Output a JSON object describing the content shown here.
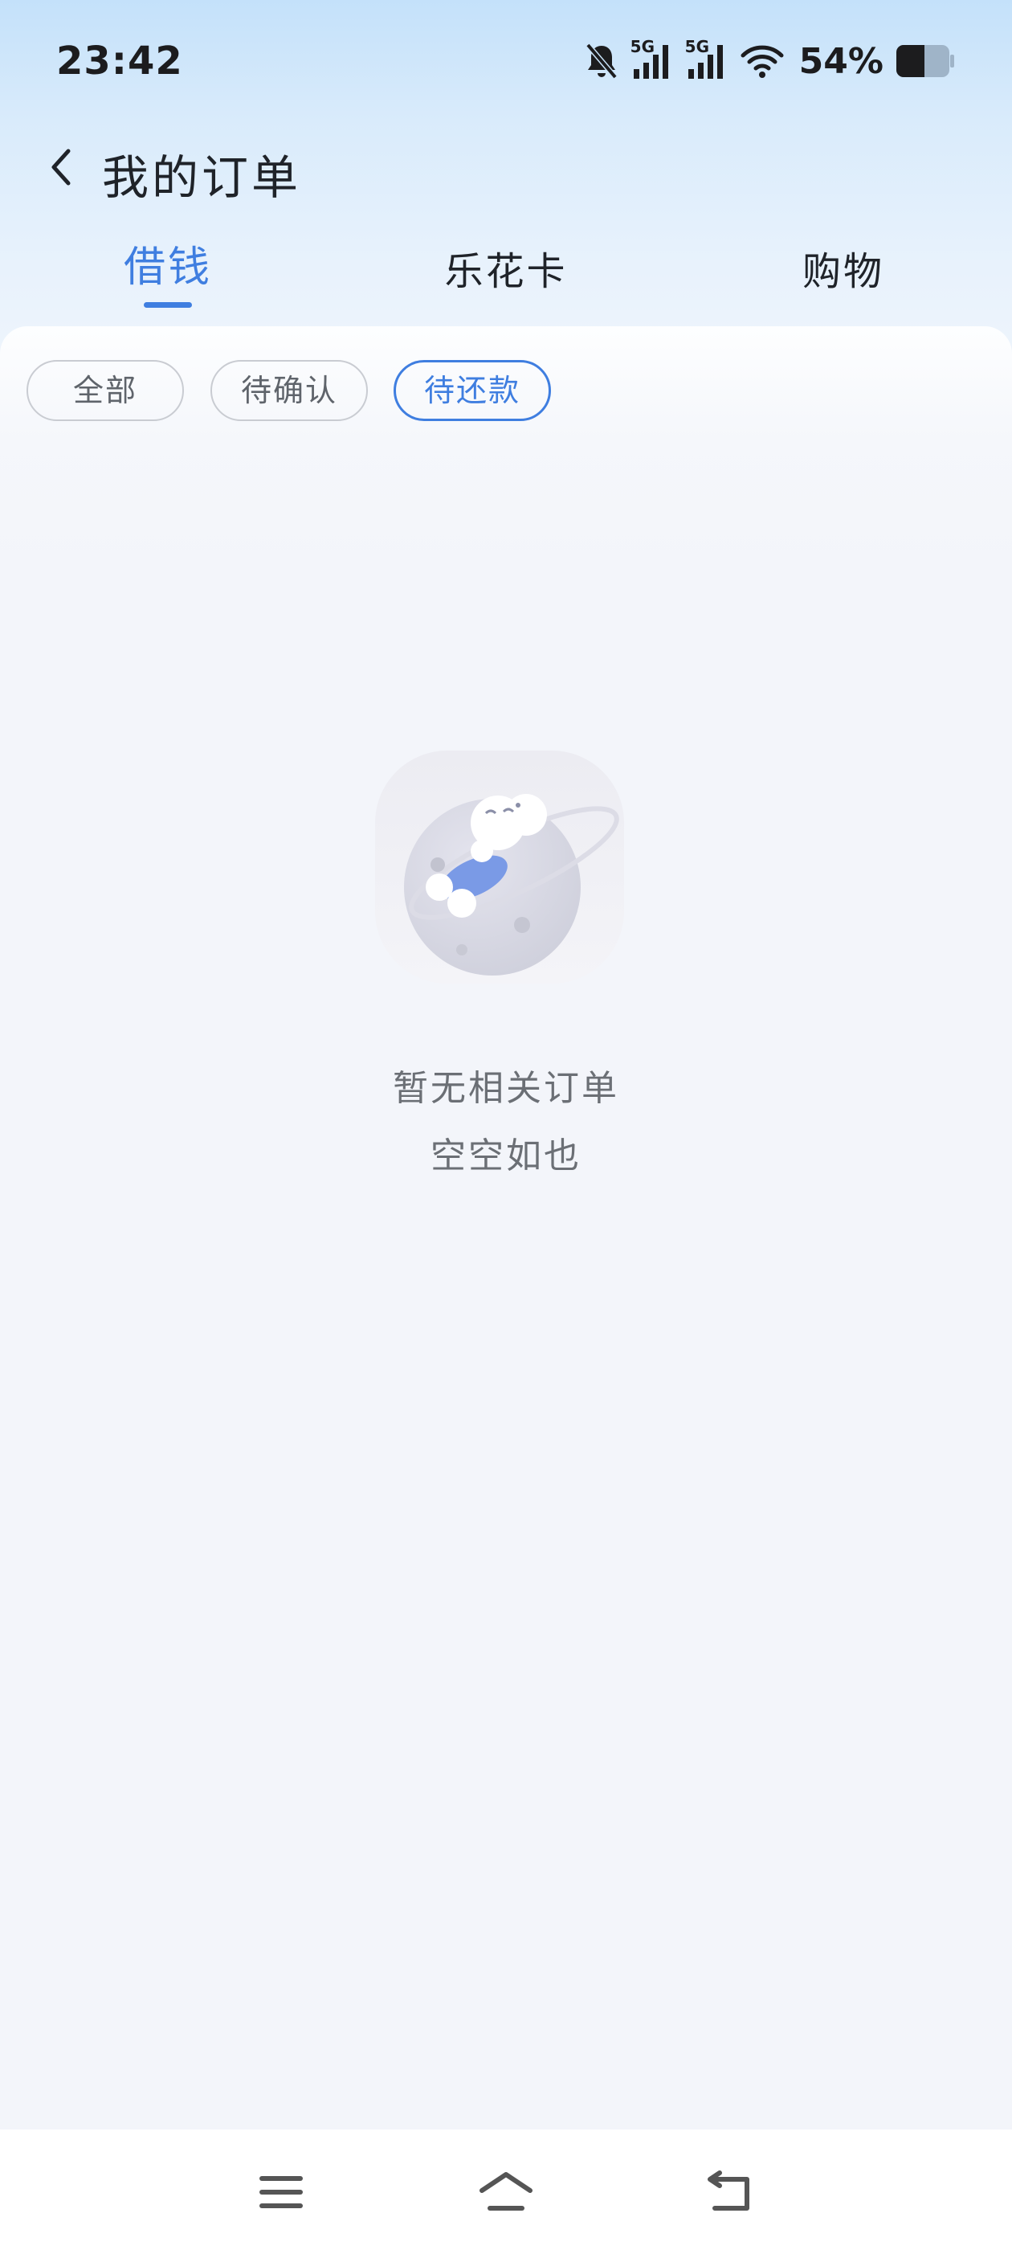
{
  "status_bar": {
    "time": "23:42",
    "network_1": "5G",
    "network_2": "5G",
    "battery": "54%",
    "icons": [
      "bell-off-icon",
      "signal-5g-icon",
      "signal-5g-icon",
      "wifi-icon",
      "battery-icon"
    ]
  },
  "header": {
    "title": "我的订单",
    "back_icon": "chevron-left-icon"
  },
  "tabs": [
    {
      "label": "借钱",
      "active": true
    },
    {
      "label": "乐花卡",
      "active": false
    },
    {
      "label": "购物",
      "active": false
    }
  ],
  "filters": [
    {
      "label": "全部",
      "selected": false
    },
    {
      "label": "待确认",
      "selected": false
    },
    {
      "label": "待还款",
      "selected": true
    }
  ],
  "empty_state": {
    "title": "暂无相关订单",
    "subtitle": "空空如也",
    "illustration": "astronaut-on-moon-illustration"
  },
  "nav_bar": {
    "icons": [
      "menu-icon",
      "home-icon",
      "back-icon"
    ]
  },
  "colors": {
    "accent": "#3f7ee0",
    "text_primary": "#1f2329",
    "text_secondary": "#6b6f75",
    "background": "#f3f5fa",
    "header_gradient_top": "#c4e1fa"
  }
}
